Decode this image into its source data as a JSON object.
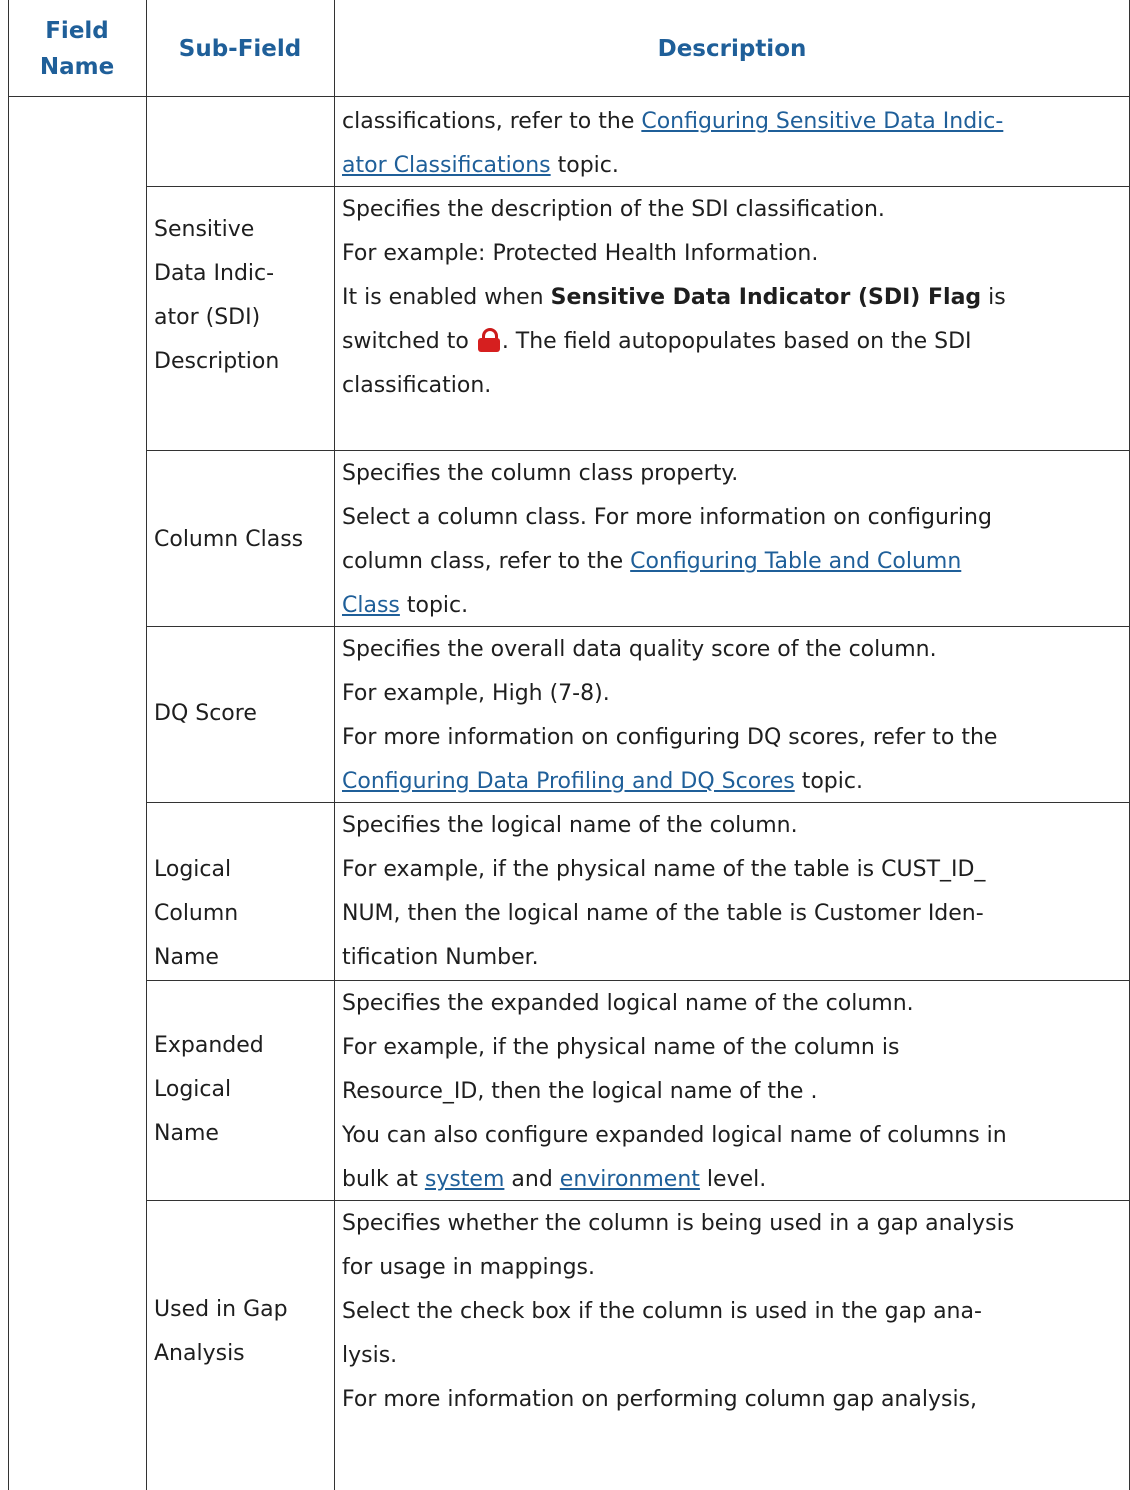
{
  "header": {
    "field_name": "Field Name",
    "sub_field": "Sub-Field",
    "description": "Description"
  },
  "rows": [
    {
      "sub_field": "",
      "lines": [
        {
          "pre": "classifications, refer to the ",
          "link": "Configuring Sensitive Data Indic-"
        },
        {
          "link": "ator Classifications",
          "post": " topic."
        }
      ]
    },
    {
      "sub_field": "Sensitive Data Indic-ator (SDI) Description",
      "lines": [
        {
          "text": "Specifies the description of the SDI classification."
        },
        {
          "text": "For example: Protected Health Information."
        },
        {
          "pre": "It is enabled when ",
          "bold": "Sensitive Data Indicator (SDI) Flag",
          "post": " is"
        },
        {
          "pre": "switched to ",
          "icon": "lock-icon",
          "post": ". The field autopopulates based on the SDI"
        },
        {
          "text": "classification."
        }
      ]
    },
    {
      "sub_field": "Column Class",
      "lines": [
        {
          "text": "Specifies the column class property."
        },
        {
          "text": "Select a column class. For more information on configuring"
        },
        {
          "pre": "column class, refer to the ",
          "link": "Configuring Table and Column "
        },
        {
          "link": "Class",
          "post": " topic."
        }
      ]
    },
    {
      "sub_field": "DQ Score",
      "lines": [
        {
          "text": "Specifies the overall data quality score of the column."
        },
        {
          "text": "For example, High (7-8)."
        },
        {
          "text": "For more information on configuring DQ scores, refer to the"
        },
        {
          "link": "Configuring Data Profiling and DQ Scores",
          "post": " topic."
        }
      ]
    },
    {
      "sub_field": "Logical Column Name",
      "lines": [
        {
          "text": "Specifies the logical name of the column."
        },
        {
          "text": "For example, if the physical name of the table is CUST_ID_"
        },
        {
          "text": "NUM, then the logical name of the table is Customer Iden-"
        },
        {
          "text": "tification Number."
        }
      ]
    },
    {
      "sub_field": "Expanded Logical Name",
      "lines": [
        {
          "text": "Specifies the expanded logical name of the column."
        },
        {
          "text": "For example, if the physical name of the column is"
        },
        {
          "text": "Resource_ID, then the logical name of the ."
        },
        {
          "text": "You can also configure expanded logical name of columns in"
        },
        {
          "pre": "bulk at ",
          "link": "system",
          "mid": " and ",
          "link2": "environment",
          "post": " level."
        }
      ]
    },
    {
      "sub_field": "Used in Gap Analysis",
      "lines": [
        {
          "text": "Specifies whether the column is being used in a gap analysis"
        },
        {
          "text": "for usage in mappings."
        },
        {
          "text": "Select the check box if the column is used in the gap ana-"
        },
        {
          "text": "lysis."
        },
        {
          "text": "For more information on performing column gap analysis,"
        }
      ]
    }
  ]
}
